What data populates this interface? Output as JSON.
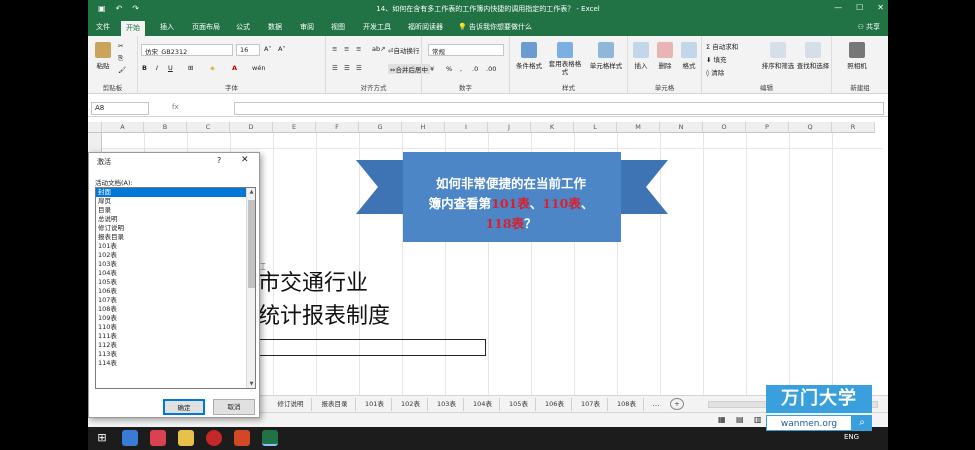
{
  "window": {
    "title": "14、如何在含有多工作表的工作簿内快捷的调用指定的工作表？ - Excel",
    "share": "共享",
    "tell_me": "告诉我你想要做什么"
  },
  "tabs": [
    "文件",
    "开始",
    "插入",
    "页面布局",
    "公式",
    "数据",
    "审阅",
    "视图",
    "开发工具",
    "福昕阅读器"
  ],
  "ribbon": {
    "clipboard": {
      "label": "剪贴板",
      "paste": "粘贴"
    },
    "font": {
      "label": "字体",
      "name": "仿宋_GB2312",
      "size": "16"
    },
    "alignment": {
      "label": "对齐方式",
      "wrap": "自动换行",
      "merge": "合并后居中"
    },
    "number": {
      "label": "数字",
      "format": "常规"
    },
    "styles": {
      "label": "样式",
      "conditional": "条件格式",
      "table": "套用表格格式",
      "cell": "单元格样式"
    },
    "cells": {
      "label": "单元格",
      "insert": "插入",
      "delete": "删除",
      "format": "格式"
    },
    "editing": {
      "label": "编辑",
      "autosum": "自动求和",
      "fill": "填充",
      "clear": "清除",
      "sort": "排序和筛选",
      "find": "查找和选择"
    },
    "new_group": {
      "label": "新建组",
      "camera": "照相机"
    }
  },
  "formula_bar": {
    "name_box": "A8",
    "fx": "fx",
    "value": ""
  },
  "columns": [
    "A",
    "B",
    "C",
    "D",
    "E",
    "F",
    "G",
    "H",
    "I",
    "J",
    "K",
    "L",
    "M",
    "N",
    "O",
    "P",
    "Q",
    "R"
  ],
  "sheet_text": {
    "line1": "市交通行业",
    "line2": "统计报表制度"
  },
  "callout": {
    "text1": "如何非常便捷的在当前工作",
    "text2": "簿内查看第",
    "red1": "101表",
    "sep1": "、",
    "red2": "110表",
    "sep2": "、",
    "red3": "118表",
    "end": "？"
  },
  "dialog": {
    "title": "激活",
    "help": "?",
    "close": "✕",
    "list_label": "活动文档(A):",
    "items": [
      "封面",
      "扉页",
      "目录",
      "总说明",
      "修订说明",
      "报表目录",
      "101表",
      "102表",
      "103表",
      "104表",
      "105表",
      "106表",
      "107表",
      "108表",
      "109表",
      "110表",
      "111表",
      "112表",
      "113表",
      "114表"
    ],
    "ok": "确定",
    "cancel": "取消"
  },
  "sheet_tabs": [
    "修订说明",
    "报表目录",
    "101表",
    "102表",
    "103表",
    "104表",
    "105表",
    "106表",
    "107表",
    "108表"
  ],
  "logo": {
    "name": "万门大学",
    "url": "wanmen.org"
  },
  "taskbar": {
    "lang": "ENG"
  },
  "colors": {
    "excel_green": "#217346",
    "callout_blue": "#4d86c6",
    "highlight_red": "#d8202f",
    "logo_blue": "#3aa0dd"
  }
}
